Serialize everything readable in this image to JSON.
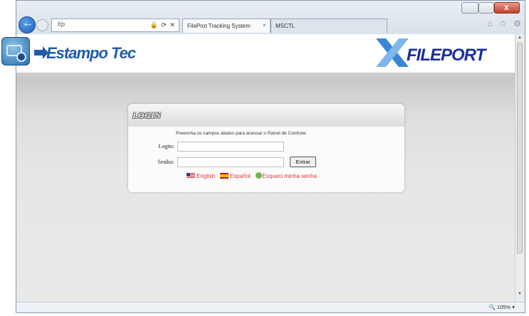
{
  "browser": {
    "address_text": "f/p",
    "address_icons": "🔒 ⟳ ✕",
    "tabs": [
      {
        "label": "FileProt Tracking System",
        "close": "×"
      },
      {
        "label": "MSCTL"
      }
    ],
    "toolbar_icons": "⌂ ☆ ⚙"
  },
  "header": {
    "brand_left": "Estampo Tec",
    "brand_right": "FILEPORT"
  },
  "login": {
    "title": "LOGIN",
    "instructions": "Preencha os campos abaixo para acessar o Painel de Controle:",
    "login_label": "Login:",
    "password_label": "Senha:",
    "submit_label": "Entrar",
    "links": {
      "english": "English",
      "espanol": "Español",
      "forgot": "Esqueci minha senha"
    }
  },
  "status": {
    "zoom": "105%"
  },
  "colors": {
    "brand_blue": "#1f5ca8",
    "link_red": "#e23737",
    "accent_navy": "#1c2fa0"
  }
}
